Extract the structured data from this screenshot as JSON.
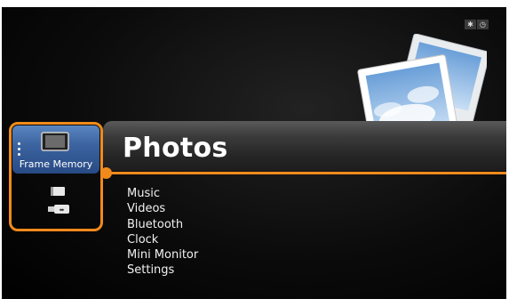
{
  "header": {
    "title": "Photos"
  },
  "sidebar": {
    "selected_label": "Frame Memory",
    "items": [
      {
        "icon": "photo-frame-icon"
      },
      {
        "icon": "memory-card-icon"
      },
      {
        "icon": "usb-drive-icon"
      }
    ]
  },
  "menu": {
    "items": [
      {
        "label": "Music"
      },
      {
        "label": "Videos"
      },
      {
        "label": "Bluetooth"
      },
      {
        "label": "Clock"
      },
      {
        "label": "Mini Monitor"
      },
      {
        "label": "Settings"
      }
    ]
  },
  "status_icons": [
    "bluetooth-icon",
    "clock-icon"
  ],
  "colors": {
    "accent": "#f08a1c",
    "selected": "#3c64a0",
    "background": "#000000"
  }
}
